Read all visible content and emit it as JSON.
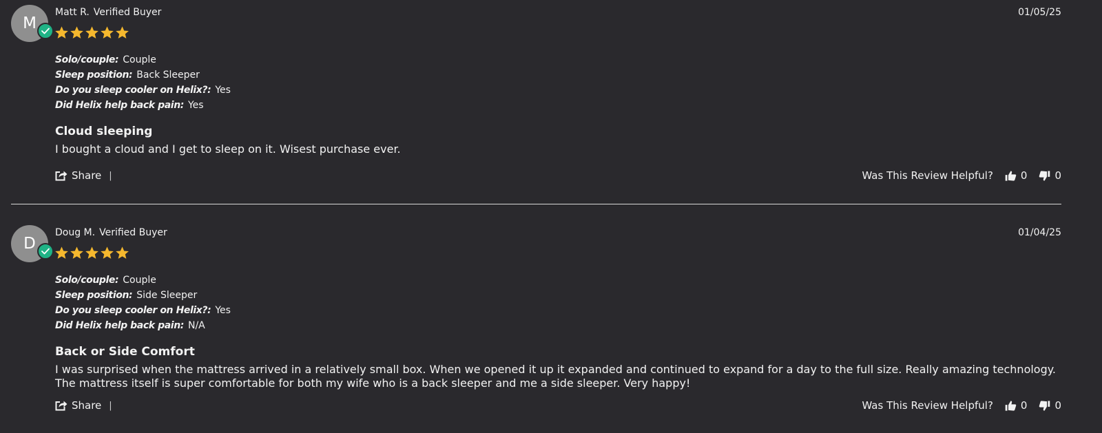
{
  "colors": {
    "background": "#2a292d",
    "star": "#f5b82e",
    "verified_badge": "#1fb386",
    "avatar": "#8f8f8f"
  },
  "helpful_label": "Was This Review Helpful?",
  "share_label": "Share",
  "share_separator": "|",
  "reviews": [
    {
      "avatar_initial": "M",
      "author": "Matt R.",
      "badge": "Verified Buyer",
      "date": "01/05/25",
      "rating": 5,
      "questions": [
        {
          "q": "Solo/couple:",
          "a": "Couple"
        },
        {
          "q": "Sleep position:",
          "a": "Back Sleeper"
        },
        {
          "q": "Do you sleep cooler on Helix?:",
          "a": "Yes"
        },
        {
          "q": "Did Helix help back pain:",
          "a": "Yes"
        }
      ],
      "title": "Cloud sleeping",
      "body": "I bought a cloud and I get to sleep on it. Wisest purchase ever.",
      "thumbs_up": "0",
      "thumbs_down": "0"
    },
    {
      "avatar_initial": "D",
      "author": "Doug M.",
      "badge": "Verified Buyer",
      "date": "01/04/25",
      "rating": 5,
      "questions": [
        {
          "q": "Solo/couple:",
          "a": "Couple"
        },
        {
          "q": "Sleep position:",
          "a": "Side Sleeper"
        },
        {
          "q": "Do you sleep cooler on Helix?:",
          "a": "Yes"
        },
        {
          "q": "Did Helix help back pain:",
          "a": "N/A"
        }
      ],
      "title": "Back or Side Comfort",
      "body": "I was surprised when the mattress arrived in a relatively small box. When we opened it up it expanded and continued to expand for a day to the full size. Really amazing technology. The mattress itself is super comfortable for both my wife who is a back sleeper and me a side sleeper. Very happy!",
      "thumbs_up": "0",
      "thumbs_down": "0"
    }
  ]
}
